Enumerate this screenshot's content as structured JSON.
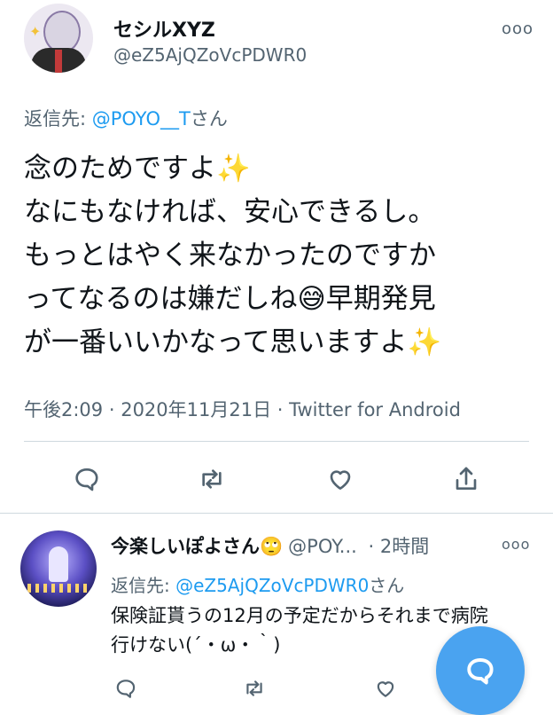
{
  "main_tweet": {
    "display_name": "セシルXYZ",
    "handle": "@eZ5AjQZoVcPDWR0",
    "more_label": "ooo",
    "reply_prefix": "返信先: ",
    "reply_mention": "@POYO__T",
    "reply_suffix": "さん",
    "lines": [
      "念のためですよ✨",
      "なにもなければ、安心できるし。",
      "もっとはやく来なかったのですか",
      "ってなるのは嫌だしね😅早期発見",
      "が一番いいかなって思いますよ✨"
    ],
    "time": "午後2:09",
    "date": "2020年11月21日",
    "source": "Twitter for Android",
    "separator": " · "
  },
  "reply_tweet": {
    "display_name": "今楽しいぽよさん🙄",
    "handle": "@POY...",
    "time_ago": "· 2時間",
    "more_label": "ooo",
    "reply_prefix": "返信先: ",
    "reply_mention": "@eZ5AjQZoVcPDWR0",
    "reply_suffix": "さん",
    "lines": [
      "保険証貰うの12月の予定だからそれまで病院",
      "行けない(´・ω・｀)"
    ]
  },
  "icons": {
    "reply": "reply-icon",
    "retweet": "retweet-icon",
    "like": "like-icon",
    "share": "share-icon",
    "compose": "compose-icon"
  },
  "colors": {
    "accent": "#1d9bf0",
    "secondary_text": "#536471",
    "fab": "#4aa3f0"
  }
}
